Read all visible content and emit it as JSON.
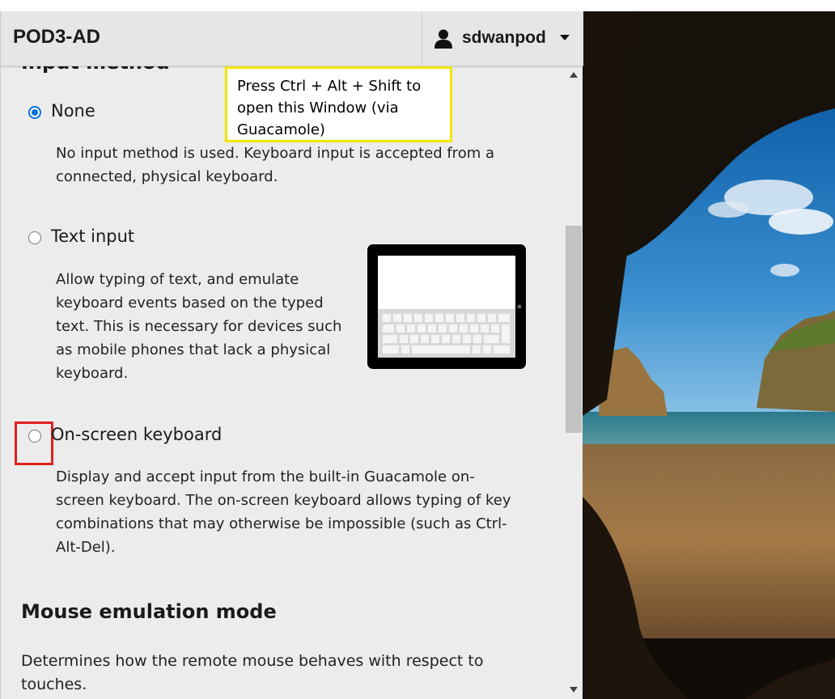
{
  "menu": {
    "title": "POD3-AD",
    "username": "sdwanpod"
  },
  "annotation": {
    "text": "Press Ctrl + Alt + Shift to open this Window (via Guacamole)"
  },
  "input_method": {
    "heading": "Input method",
    "options": [
      {
        "label": "None",
        "selected": true,
        "description": "No input method is used. Keyboard input is accepted from a connected, physical keyboard."
      },
      {
        "label": "Text input",
        "selected": false,
        "description": "Allow typing of text, and emulate keyboard events based on the typed text. This is necessary for devices such as mobile phones that lack a physical keyboard."
      },
      {
        "label": "On-screen keyboard",
        "selected": false,
        "description": "Display and accept input from the built-in Guacamole on-screen keyboard. The on-screen keyboard allows typing of key combinations that may otherwise be impossible (such as Ctrl-Alt-Del)."
      }
    ]
  },
  "mouse_emulation": {
    "heading": "Mouse emulation mode",
    "description": "Determines how the remote mouse behaves with respect to touches."
  },
  "icons": {
    "user": "user-icon",
    "caret": "chevron-down-icon",
    "scroll_up": "scroll-up-icon",
    "scroll_down": "scroll-down-icon",
    "tablet": "tablet-keyboard-icon"
  },
  "colors": {
    "accent": "#0b6fe0",
    "annotation_border": "#f2e600",
    "highlight_border": "#e02020"
  }
}
